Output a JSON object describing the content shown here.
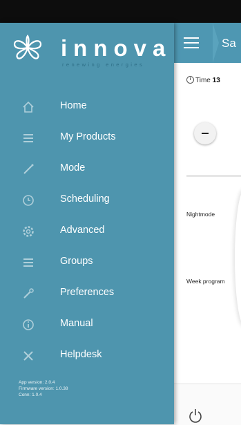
{
  "header": {
    "title": "Sa"
  },
  "main": {
    "time_label": "Time",
    "time_value": "13",
    "rows": [
      "Nightmode",
      "Week program"
    ]
  },
  "drawer": {
    "brand": "innova",
    "tagline": "renewing energies",
    "items": [
      {
        "label": "Home",
        "icon": "home-icon"
      },
      {
        "label": "My Products",
        "icon": "list-icon"
      },
      {
        "label": "Mode",
        "icon": "wand-icon"
      },
      {
        "label": "Scheduling",
        "icon": "clock-icon"
      },
      {
        "label": "Advanced",
        "icon": "gear-icon"
      },
      {
        "label": "Groups",
        "icon": "list-icon"
      },
      {
        "label": "Preferences",
        "icon": "tools-icon"
      },
      {
        "label": "Manual",
        "icon": "info-icon"
      },
      {
        "label": "Helpdesk",
        "icon": "tools-cross-icon"
      }
    ],
    "version_lines": [
      "App version: 2.0.4",
      "Firmware version: 1.0.38",
      "Conn: 1.0.4"
    ]
  },
  "colors": {
    "drawer_bg": "#4e95ae",
    "accent": "#4e97b2",
    "status_bar": "#0d0d0d"
  }
}
